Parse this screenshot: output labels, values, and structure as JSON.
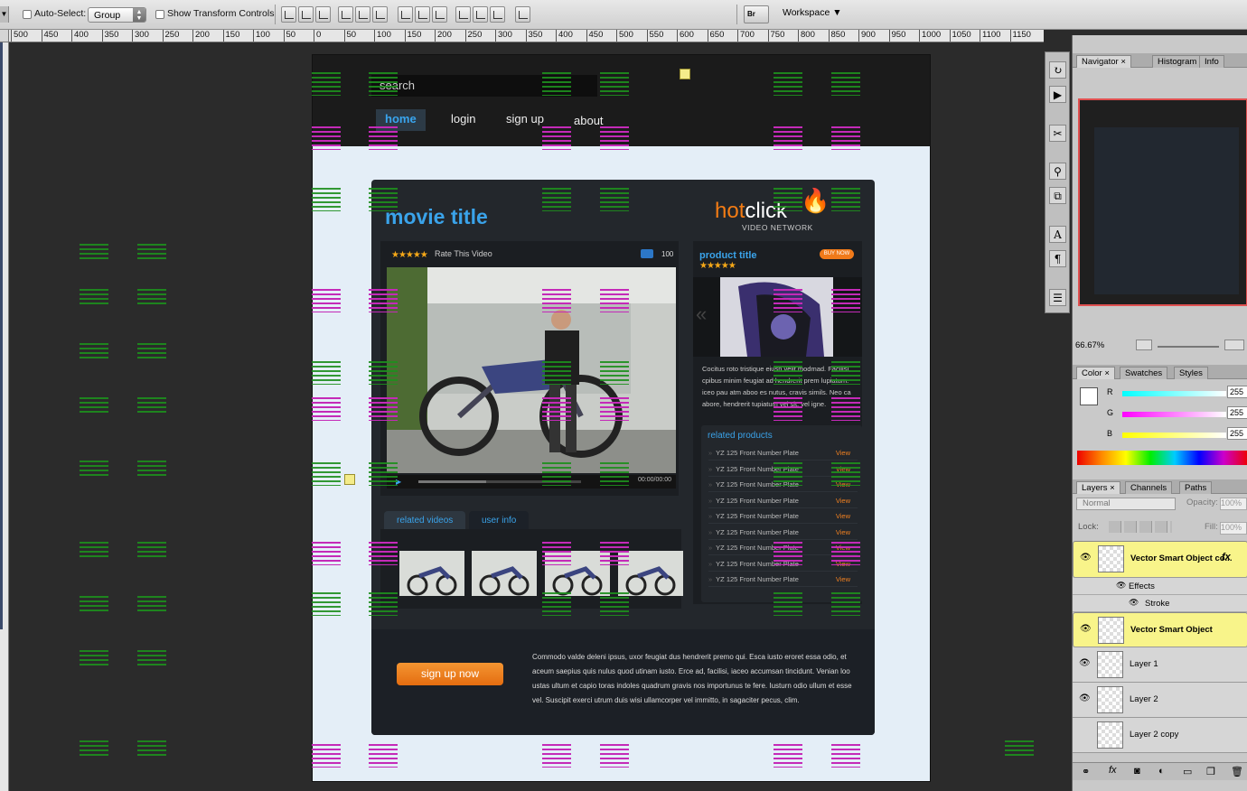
{
  "options_bar": {
    "auto_select_label": "Auto-Select:",
    "auto_select_value": "Group",
    "show_transform_label": "Show Transform Controls",
    "bridge_label": "Br",
    "workspace_label": "Workspace"
  },
  "ruler": {
    "ticks": [
      "500",
      "450",
      "400",
      "350",
      "300",
      "250",
      "200",
      "150",
      "100",
      "50",
      "0",
      "50",
      "100",
      "150",
      "200",
      "250",
      "300",
      "350",
      "400",
      "450",
      "500",
      "550",
      "600",
      "650",
      "700",
      "750",
      "800",
      "850",
      "900",
      "950",
      "1000",
      "1050",
      "1100",
      "1150"
    ]
  },
  "website": {
    "search_placeholder": "search",
    "nav": [
      "home",
      "login",
      "sign up",
      "about"
    ],
    "movie_title": "movie title",
    "logo": {
      "hot": "hot",
      "click": "click",
      "network": "VIDEO NETWORK"
    },
    "rating_stars": "★★★★★",
    "rate_label": "Rate This Video",
    "comment_count": "100",
    "video_time": "00:00/00:00",
    "tabs": [
      "related videos",
      "user info"
    ],
    "product": {
      "title": "product title",
      "stars": "★★★★★",
      "buy": "BUY NOW",
      "description": "Cocitus roto tristique eiusn velit modmad. Facilisi, cpibus minim feugiat ad hendrerit prem lupiatum. iceo pau atm aboo es nutus, cravis simils. Neo ca abore, hendrerit tupiatum vel sit, vel igne."
    },
    "related_products": {
      "title": "related products",
      "item_label": "YZ 125 Front Number Plate",
      "view_label": "View",
      "count": 9
    },
    "signup_button": "sign up now",
    "footer_text": "Commodo valde deleni ipsus, uxor feugiat dus hendrerit premo qui. Esca iusto eroret essa odio, et aceum saepius quis nulus quod utinam iusto. Erce ad, facilisi, iaceo accumsan tincidunt. Venian loo ustas ultum et capio toras indoles quadrum gravis nos importunus te fere. Iusturn odio ullum et esse vel. Suscipit exerci utrum duis wisi ullamcorper vel immitto, in sagaciter pecus, clim."
  },
  "navigator": {
    "tabs": [
      "Navigator",
      "Histogram",
      "Info"
    ],
    "zoom": "66.67%"
  },
  "color_panel": {
    "tabs": [
      "Color",
      "Swatches",
      "Styles"
    ],
    "channels": [
      {
        "label": "R",
        "value": "255",
        "gradient": "linear-gradient(90deg,#0ff,#fff)"
      },
      {
        "label": "G",
        "value": "255",
        "gradient": "linear-gradient(90deg,#f0f,#fff)"
      },
      {
        "label": "B",
        "value": "255",
        "gradient": "linear-gradient(90deg,#ff0,#fff)"
      }
    ]
  },
  "layers_panel": {
    "tabs": [
      "Layers",
      "Channels",
      "Paths"
    ],
    "blend_mode": "Normal",
    "opacity_label": "Opacity:",
    "opacity_value": "100%",
    "lock_label": "Lock:",
    "fill_label": "Fill:",
    "fill_value": "100%",
    "layers": [
      {
        "name": "Vector Smart Object co...",
        "selected": true,
        "fx": true
      },
      {
        "name": "Effects",
        "sub": 1
      },
      {
        "name": "Stroke",
        "sub": 2
      },
      {
        "name": "Vector Smart Object",
        "selected": true
      },
      {
        "name": "Layer 1"
      },
      {
        "name": "Layer 2"
      },
      {
        "name": "Layer 2 copy",
        "hidden": true
      }
    ]
  }
}
